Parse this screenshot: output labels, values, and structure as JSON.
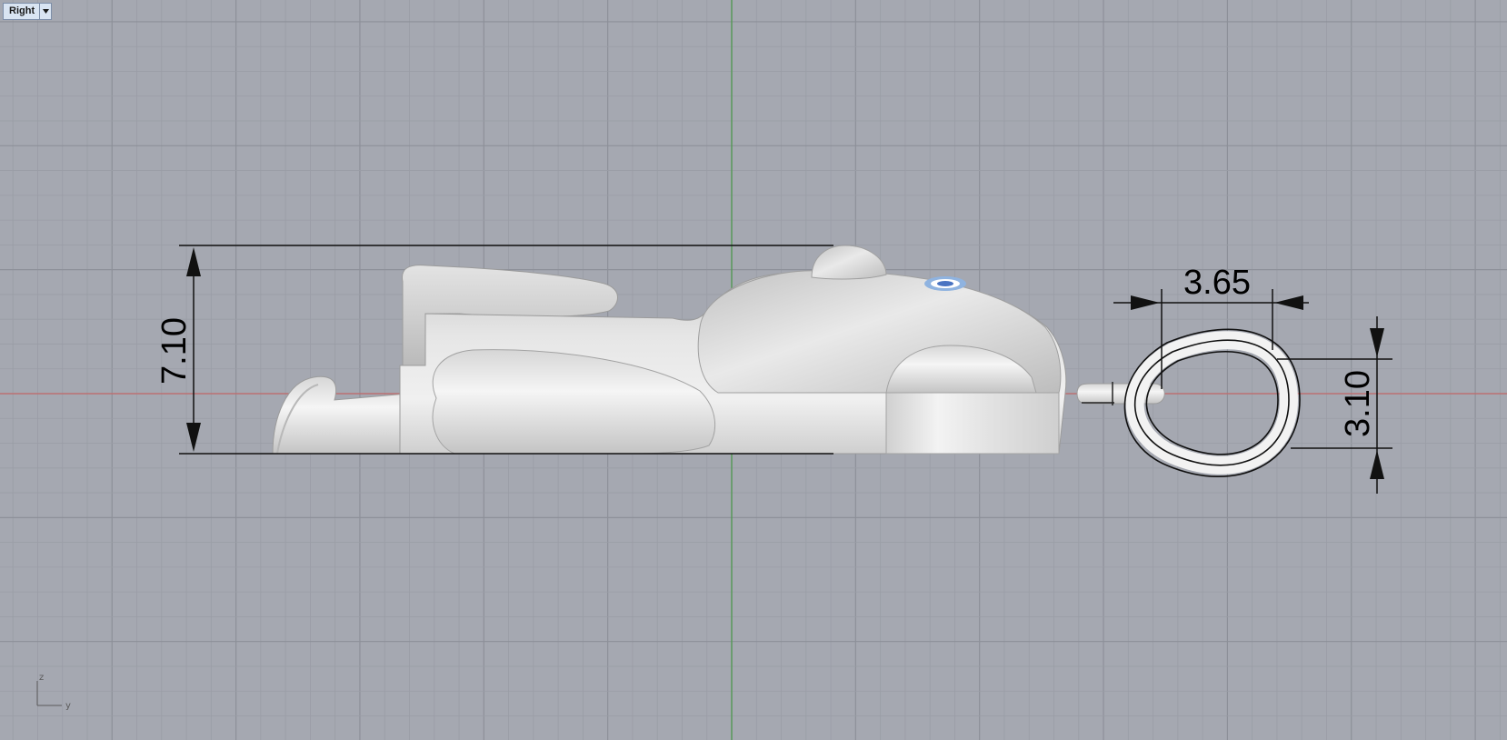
{
  "viewport": {
    "name": "Right",
    "menu_icon": "chevron-down-icon"
  },
  "dimensions": {
    "overall_height": "7.10",
    "bail_width": "3.65",
    "bail_height": "3.10"
  },
  "axis_indicator": {
    "vertical": "z",
    "horizontal": "y"
  },
  "colors": {
    "background": "#a5a8b1",
    "grid_minor": "#9a9da6",
    "grid_major": "#8d9099",
    "x_axis": "#c46a6a",
    "z_axis": "#4f9a4f",
    "model": "#dcdcdc",
    "tab_bg": "#d9e4f2"
  }
}
